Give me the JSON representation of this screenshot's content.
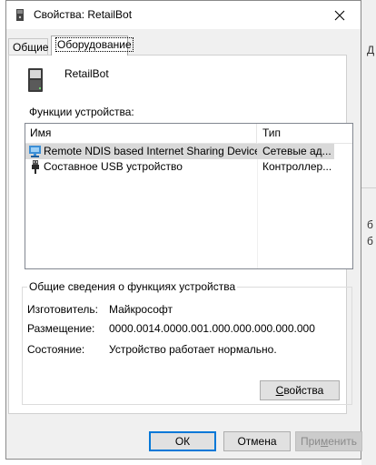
{
  "window": {
    "title": "Свойства: RetailBot"
  },
  "tabs": [
    {
      "label": "Общие",
      "active": false
    },
    {
      "label": "Оборудование",
      "active": true
    }
  ],
  "device": {
    "name": "RetailBot",
    "icon": "device-icon"
  },
  "functions": {
    "label": "Функции устройства:",
    "columns": [
      "Имя",
      "Тип"
    ],
    "rows": [
      {
        "name": "Remote NDIS based Internet Sharing Device",
        "type": "Сетевые ад...",
        "icon": "network-adapter-icon",
        "selected": true
      },
      {
        "name": "Составное USB устройство",
        "type": "Контроллер...",
        "icon": "usb-icon",
        "selected": false
      }
    ]
  },
  "summary": {
    "legend": "Общие сведения о функциях устройства",
    "manufacturer_label": "Изготовитель:",
    "manufacturer_value": "Майкрософт",
    "location_label": "Размещение:",
    "location_value": "0000.0014.0000.001.000.000.000.000.000",
    "status_label": "Состояние:",
    "status_value": "Устройство работает нормально.",
    "properties_button": {
      "pre": "",
      "accel": "С",
      "post": "войства"
    }
  },
  "buttons": {
    "ok": "ОК",
    "cancel": "Отмена",
    "apply": {
      "pre": "При",
      "accel": "м",
      "post": "енить",
      "enabled": false
    }
  },
  "background": {
    "fragments": [
      "Д",
      "б",
      "б"
    ]
  },
  "colors": {
    "selection": "#d9d9d9",
    "default_button_border": "#0078d7",
    "network_icon": "#3c8fd6"
  }
}
